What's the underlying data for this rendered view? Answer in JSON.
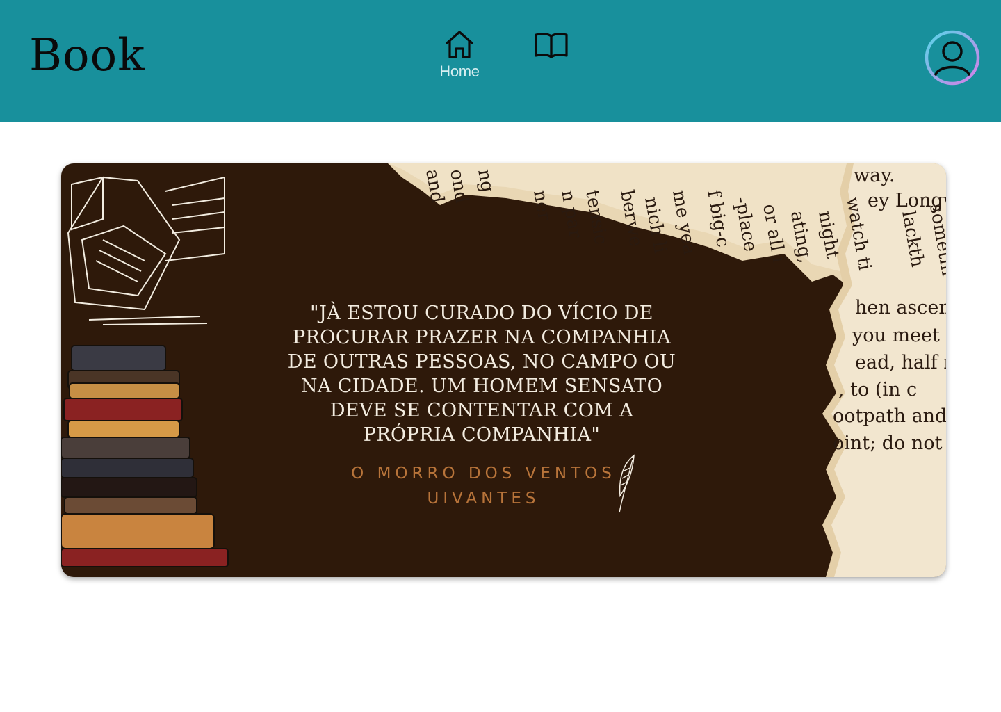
{
  "header": {
    "logo": "Book",
    "nav": [
      {
        "id": "home",
        "label": "Home",
        "icon": "home-icon"
      },
      {
        "id": "library",
        "label": "",
        "icon": "open-book-icon"
      }
    ],
    "profile_icon": "user-avatar-icon"
  },
  "banner": {
    "quote": "\"Jà estou curado do vício de procurar prazer na companhia de outras pessoas, no campo ou na cidade. Um homem sensato deve se contentar com a própria companhia\"",
    "source": "O Morro dos Ventos Uivantes",
    "paper_snippets": [
      "way.",
      "ey Longw",
      "hen ascen",
      "you meet a",
      "ead, half r",
      ", to  (in  c",
      "ootpath  and",
      "oint; do not c"
    ]
  },
  "colors": {
    "header_bg": "#18909c",
    "banner_bg": "#2e190a",
    "quote_text": "#f3ece0",
    "source_text": "#b8743a",
    "paper": "#f1e3c8"
  }
}
